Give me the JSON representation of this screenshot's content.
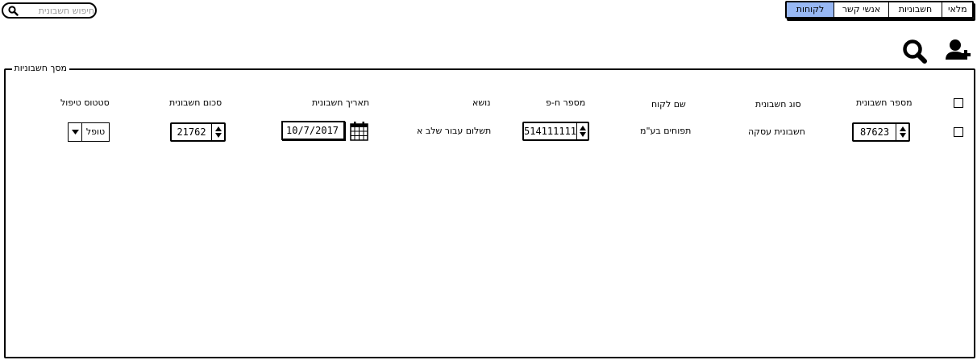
{
  "search": {
    "placeholder": "חיפוש חשבונית",
    "value": ""
  },
  "tabs": [
    {
      "label": "מלאי",
      "active": false
    },
    {
      "label": "חשבוניות",
      "active": false
    },
    {
      "label": "אנשי קשר",
      "active": false
    },
    {
      "label": "לקוחות",
      "active": true
    }
  ],
  "toolbar": {
    "icons": [
      "add-user-icon",
      "search-icon"
    ]
  },
  "panel": {
    "title": "מסך חשבוניות"
  },
  "table": {
    "headers": {
      "invoice_number": "מספר חשבונית",
      "invoice_type": "סוג חשבונית",
      "customer_name": "שם לקוח",
      "company_number": "מספר ח-פ",
      "subject": "נושא",
      "invoice_date": "תאריך חשבונית",
      "invoice_amount": "סכום חשבונית",
      "status": "סטטוס טיפול"
    },
    "rows": [
      {
        "selected": false,
        "invoice_number": "87623",
        "invoice_type": "חשבונית עסקה",
        "customer_name": "תפוחים בע\"מ",
        "company_number": "514111111",
        "subject": "תשלום עבור שלב א",
        "invoice_date": "10/7/2017",
        "invoice_amount": "21762",
        "status": "טופל"
      }
    ]
  },
  "colors": {
    "active_tab": "#98b8f4",
    "placeholder": "#9a9a9a",
    "border": "#000000"
  }
}
